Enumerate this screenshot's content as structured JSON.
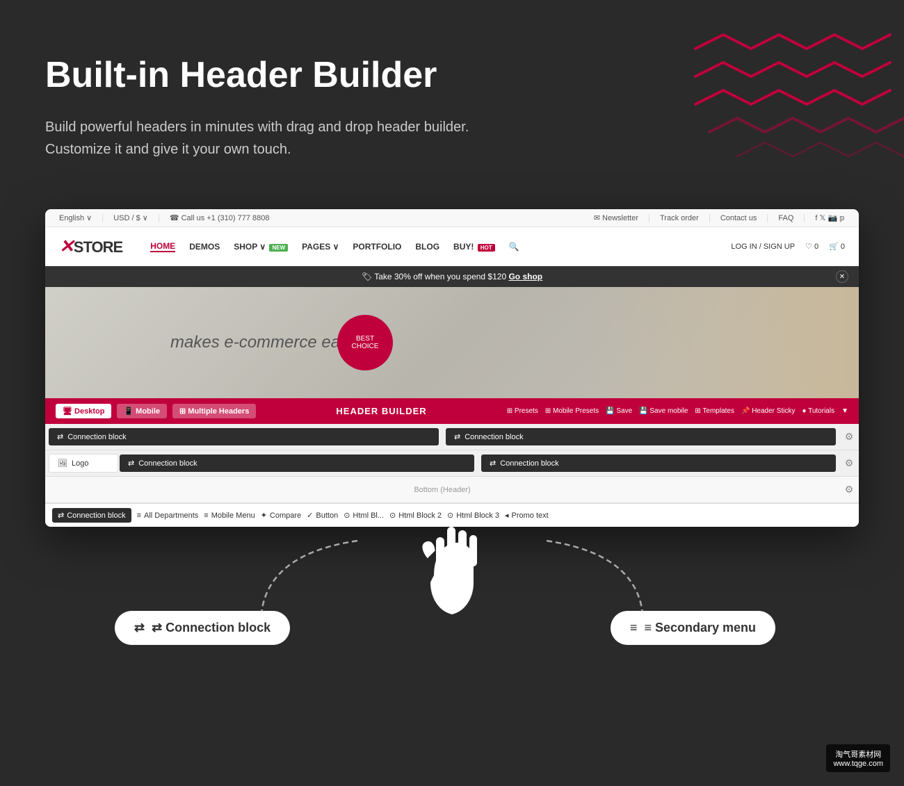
{
  "hero": {
    "title": "Built-in Header Builder",
    "description_line1": "Build powerful headers in minutes with drag and drop header builder.",
    "description_line2": "Customize it and give it your own touch."
  },
  "store": {
    "topbar": {
      "language": "English ∨",
      "currency": "USD / $ ∨",
      "phone": "☎ Call us +1 (310) 777 8808",
      "newsletter": "✉ Newsletter",
      "track_order": "Track order",
      "contact": "Contact us",
      "faq": "FAQ"
    },
    "logo": "XSTORE",
    "nav_items": [
      "HOME",
      "DEMOS",
      "SHOP",
      "PAGES",
      "PORTFOLIO",
      "BLOG",
      "BUY!"
    ],
    "nav_right": [
      "LOG IN / SIGN UP",
      "♡ 0",
      "🛒 0"
    ],
    "promo_text": "🏷 Take 30% off when you spend $120",
    "promo_link": "Go shop",
    "hero_text": "makes e-commerce easy",
    "best": "BEST",
    "choice": "CHOICE"
  },
  "header_builder": {
    "tabs": [
      "Desktop",
      "Mobile",
      "Multiple Headers"
    ],
    "center_label": "HEADER BUILDER",
    "actions": [
      "Presets",
      "Mobile Presets",
      "Save",
      "Save mobile",
      "Templates",
      "Header Sticky",
      "Tutorials"
    ]
  },
  "builder_rows": {
    "row1_left": "⇄ Connection block",
    "row1_right": "⇄ Connection block",
    "row2_logo": "🖼 Logo",
    "row2_mid": "⇄ Connection block",
    "row2_right": "⇄ Connection block",
    "row3_bottom": "Bottom (Header)",
    "elements": [
      "⇄ Connection block",
      "≡ All Departments",
      "≡ Mobile Menu",
      "✦ Compare",
      "✓ Button",
      "⊙ Html Bl...",
      "⊙ Html Block 2",
      "⊙ Html Block 3",
      "◂ Promo text"
    ]
  },
  "callouts": {
    "left": "⇄ Connection block",
    "right": "≡ Secondary menu"
  },
  "watermark": {
    "line1": "淘气哥素材网",
    "line2": "www.tqge.com"
  }
}
